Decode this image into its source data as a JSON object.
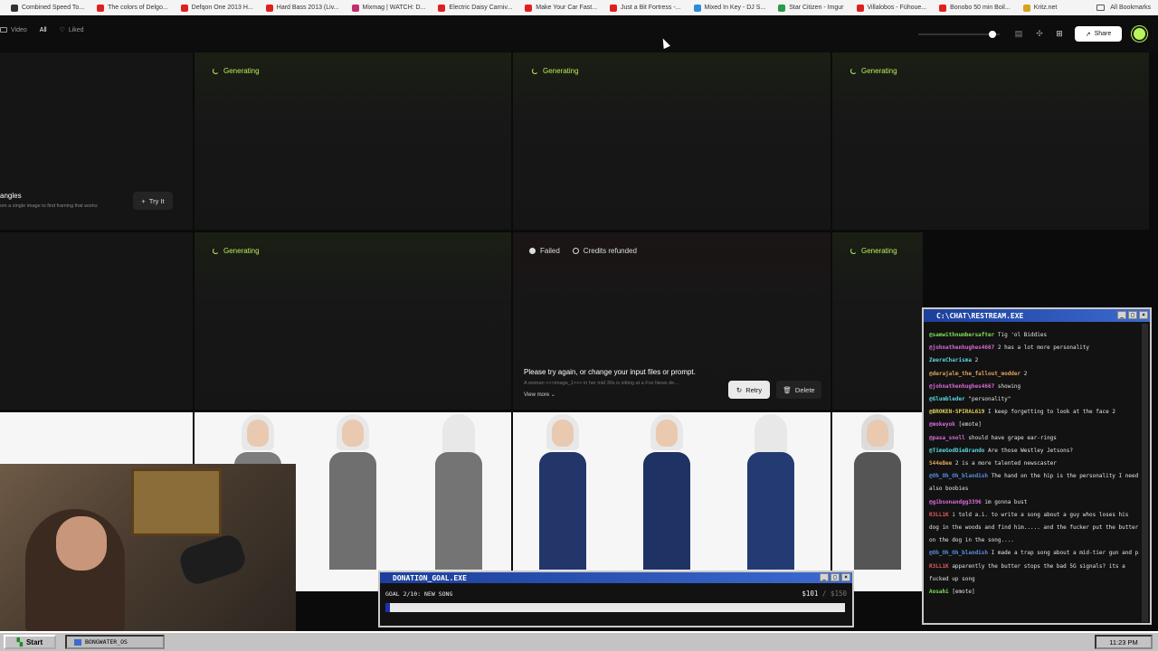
{
  "bookmarks": [
    {
      "label": "Combined Speed To...",
      "color": "#333333"
    },
    {
      "label": "The colors of Delgo...",
      "color": "#e02020"
    },
    {
      "label": "Defqon One 2013 H...",
      "color": "#e02020"
    },
    {
      "label": "Hard Bass 2013 (Liv...",
      "color": "#e02020"
    },
    {
      "label": "Mixmag | WATCH: D...",
      "color": "#c0306a"
    },
    {
      "label": "Electric Daisy Carniv...",
      "color": "#e02020"
    },
    {
      "label": "Make Your Car Fast...",
      "color": "#e02020"
    },
    {
      "label": "Just a Bit Fortress -...",
      "color": "#e02020"
    },
    {
      "label": "Mixed In Key - DJ S...",
      "color": "#2f8ad8"
    },
    {
      "label": "Star Citizen - Imgur",
      "color": "#2b9a4a"
    },
    {
      "label": "Villalobos - Fühoue...",
      "color": "#e02020"
    },
    {
      "label": "Bonobo 50 min Boil...",
      "color": "#e02020"
    },
    {
      "label": "Kritz.net",
      "color": "#d8a020"
    }
  ],
  "all_bookmarks": "All Bookmarks",
  "filters": {
    "video": "Video",
    "all": "All",
    "liked": "Liked"
  },
  "share_label": "Share",
  "generating_label": "Generating",
  "angles": {
    "title": "angles",
    "subtitle": "om a single image to find framing that works",
    "try_label": "Try It"
  },
  "failed": {
    "status": "Failed",
    "refund": "Credits refunded",
    "message": "Please try again, or change your input files or prompt.",
    "prompt": "A woman <<<image_1>>> in her mid 30s is sitting at a Fox News de...",
    "view_more": "View more",
    "retry": "Retry",
    "delete": "Delete"
  },
  "chat": {
    "title": "C:\\CHAT\\RESTREAM.EXE",
    "lines": [
      {
        "user": "@samwithnumbersafter",
        "text": "Tig 'ol Biddies",
        "color": "#7ee05a"
      },
      {
        "user": "@johnathenhughes4667",
        "text": "2 has a lot more personality",
        "color": "#d96ad8"
      },
      {
        "user": "ZeereCharisma",
        "text": "2",
        "color": "#5ad7e0"
      },
      {
        "user": "@derajalm_the_fallout_modder",
        "text": "2",
        "color": "#e0a35a"
      },
      {
        "user": "@johnathenhughes4667",
        "text": "showing",
        "color": "#d96ad8"
      },
      {
        "user": "@Glumbleder",
        "text": "\"personality\"",
        "color": "#5ad7e0"
      },
      {
        "user": "@BROKEN-SPIRAL619",
        "text": "I keep forgetting to look at the face 2",
        "color": "#e0d15a"
      },
      {
        "user": "@mokeyok",
        "text": "[emote]",
        "color": "#d96ad8"
      },
      {
        "user": "@pasa_snoll",
        "text": "should have grape ear-rings",
        "color": "#d96ad8"
      },
      {
        "user": "@TimeGodDieBrando",
        "text": "Are those Westley Jetsons?",
        "color": "#5ad7e0"
      },
      {
        "user": "S44eBee",
        "text": "2 is a more talented newscaster",
        "color": "#e0a35a"
      },
      {
        "user": "@Oh_Oh_Oh_blandish",
        "text": "The hand on the hip is the personality I need also boobies",
        "color": "#5a8fe0"
      },
      {
        "user": "@gibsonandgg3396",
        "text": "im gonna bust",
        "color": "#d96ad8"
      },
      {
        "user": "R3LL1K",
        "text": "i told a.i. to write a song about a guy whos loses his dog in the woods and find him..... and the fucker put the butter on the dog in the song....",
        "color": "#e05a5a"
      },
      {
        "user": "@Oh_Oh_Oh_blandish",
        "text": "I made a trap song about a mid-tier gun and pilot.",
        "color": "#5a8fe0"
      },
      {
        "user": "R3LL1K",
        "text": "apparently the butter stops the bad 5G signals? its a fucked up song",
        "color": "#e05a5a"
      },
      {
        "user": "Aosahi",
        "text": "[emote]",
        "color": "#7ee05a"
      }
    ]
  },
  "donation": {
    "title": "DONATION_GOAL.EXE",
    "goal": "GOAL 2/10: NEW SONG",
    "current": "$101",
    "target": "/ $150",
    "progress": 0.01
  },
  "taskbar": {
    "start": "Start",
    "task": "BONGWATER_OS",
    "clock": "11:23 PM"
  },
  "colors": {
    "accent": "#b8ec5e",
    "titlebar": "#1c3f9a"
  },
  "icons": [
    "video-icon",
    "heart-icon",
    "spinner-icon",
    "plus-icon",
    "retry-icon",
    "trash-icon",
    "info-icon",
    "share-icon",
    "grid-icon",
    "folder-icon"
  ]
}
